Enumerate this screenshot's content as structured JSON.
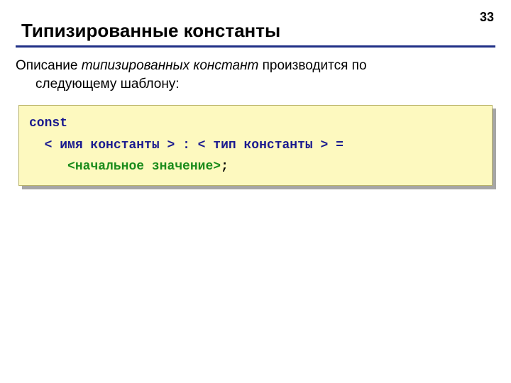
{
  "page_number": "33",
  "title": "Типизированные  константы",
  "description": {
    "prefix": "Описание ",
    "italic": "типизированных констант",
    "suffix1": " производится по",
    "line2": "следующему шаблону:"
  },
  "code": {
    "line1": "const",
    "line2": {
      "indent": "  ",
      "lt1": "<",
      "name": " имя константы ",
      "gt1": ">",
      "colon": " : ",
      "lt2": "<",
      "type": " тип константы ",
      "gt2": ">",
      "eq": " ="
    },
    "line3": {
      "indent": "     ",
      "lt": "<",
      "val": "начальное значение",
      "gt": ">",
      "semi": ";"
    }
  }
}
